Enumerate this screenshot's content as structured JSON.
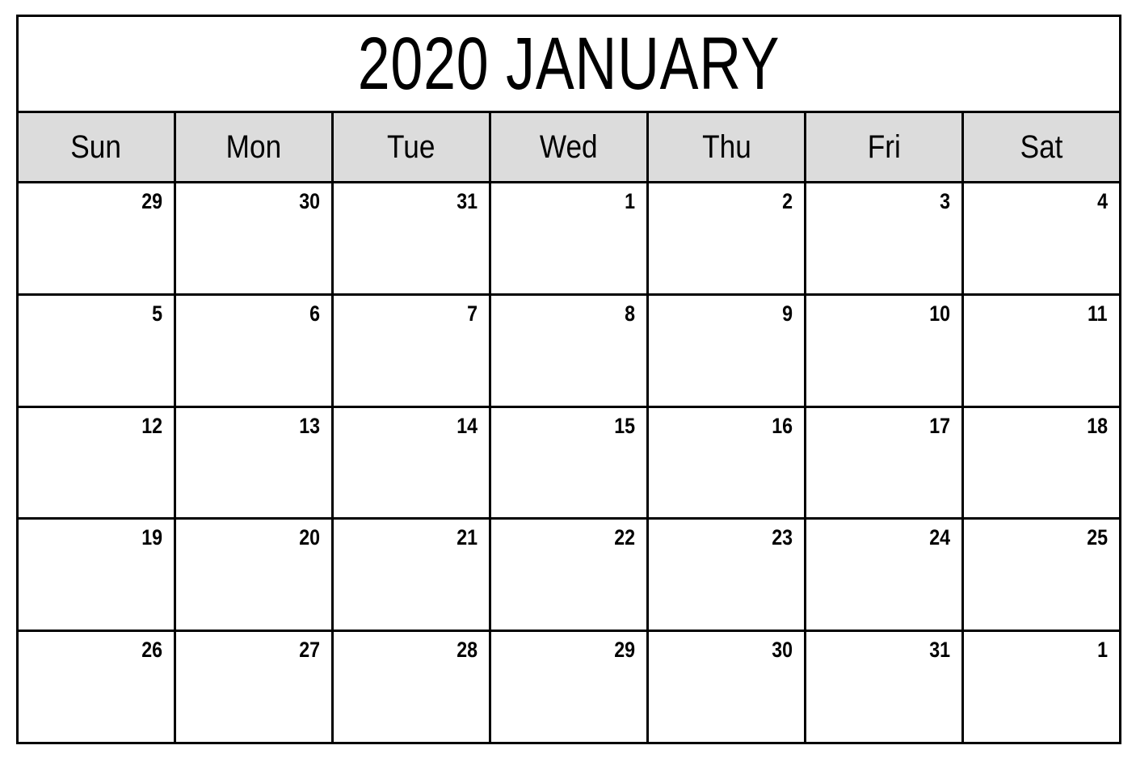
{
  "calendar": {
    "title": "2020 JANUARY",
    "year": "2020",
    "month": "JANUARY",
    "first_day_of_week": "Sun",
    "colors": {
      "border": "#000000",
      "weekday_header_background": "#dcdcdc",
      "cell_background": "#ffffff",
      "text": "#000000",
      "page_background": "#ffffff"
    },
    "weekday_headers": [
      {
        "label": "Sun"
      },
      {
        "label": "Mon"
      },
      {
        "label": "Tue"
      },
      {
        "label": "Wed"
      },
      {
        "label": "Thu"
      },
      {
        "label": "Fri"
      },
      {
        "label": "Sat"
      }
    ],
    "weeks": [
      {
        "days": [
          {
            "number": "29",
            "in_month": false
          },
          {
            "number": "30",
            "in_month": false
          },
          {
            "number": "31",
            "in_month": false
          },
          {
            "number": "1",
            "in_month": true
          },
          {
            "number": "2",
            "in_month": true
          },
          {
            "number": "3",
            "in_month": true
          },
          {
            "number": "4",
            "in_month": true
          }
        ]
      },
      {
        "days": [
          {
            "number": "5",
            "in_month": true
          },
          {
            "number": "6",
            "in_month": true
          },
          {
            "number": "7",
            "in_month": true
          },
          {
            "number": "8",
            "in_month": true
          },
          {
            "number": "9",
            "in_month": true
          },
          {
            "number": "10",
            "in_month": true
          },
          {
            "number": "11",
            "in_month": true
          }
        ]
      },
      {
        "days": [
          {
            "number": "12",
            "in_month": true
          },
          {
            "number": "13",
            "in_month": true
          },
          {
            "number": "14",
            "in_month": true
          },
          {
            "number": "15",
            "in_month": true
          },
          {
            "number": "16",
            "in_month": true
          },
          {
            "number": "17",
            "in_month": true
          },
          {
            "number": "18",
            "in_month": true
          }
        ]
      },
      {
        "days": [
          {
            "number": "19",
            "in_month": true
          },
          {
            "number": "20",
            "in_month": true
          },
          {
            "number": "21",
            "in_month": true
          },
          {
            "number": "22",
            "in_month": true
          },
          {
            "number": "23",
            "in_month": true
          },
          {
            "number": "24",
            "in_month": true
          },
          {
            "number": "25",
            "in_month": true
          }
        ]
      },
      {
        "days": [
          {
            "number": "26",
            "in_month": true
          },
          {
            "number": "27",
            "in_month": true
          },
          {
            "number": "28",
            "in_month": true
          },
          {
            "number": "29",
            "in_month": true
          },
          {
            "number": "30",
            "in_month": true
          },
          {
            "number": "31",
            "in_month": true
          },
          {
            "number": "1",
            "in_month": false
          }
        ]
      }
    ]
  }
}
